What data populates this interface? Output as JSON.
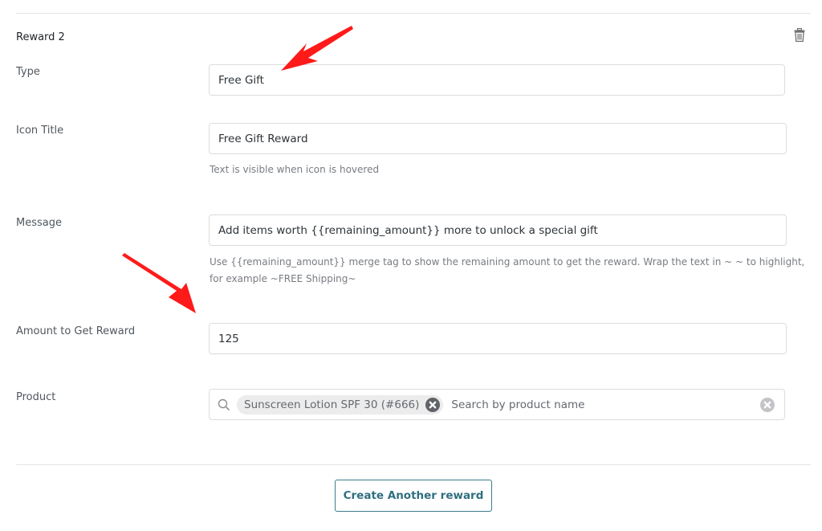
{
  "reward": {
    "title": "Reward 2",
    "delete_icon": "trash-icon",
    "fields": {
      "type": {
        "label": "Type",
        "value": "Free Gift"
      },
      "icon_title": {
        "label": "Icon Title",
        "value": "Free Gift Reward",
        "hint": "Text is visible when icon is hovered"
      },
      "message": {
        "label": "Message",
        "value": "Add items worth {{remaining_amount}} more to unlock a special gift",
        "hint_line1": "Use {{remaining_amount}} merge tag to show the remaining amount to get the reward. Wrap the text in ~ ~ to highlight,",
        "hint_line2": "for example ~FREE Shipping~"
      },
      "amount": {
        "label": "Amount to Get Reward",
        "value": "125"
      },
      "product": {
        "label": "Product",
        "selected_chip": "Sunscreen Lotion SPF 30 (#666)",
        "placeholder": "Search by product name",
        "search_icon": "search-icon",
        "clear_icon": "clear-circle-icon"
      }
    }
  },
  "actions": {
    "create_label": "Create Another reward"
  },
  "annotations": {
    "arrow_color": "#ff1a1a"
  },
  "colors": {
    "accent": "#2f6f80"
  }
}
